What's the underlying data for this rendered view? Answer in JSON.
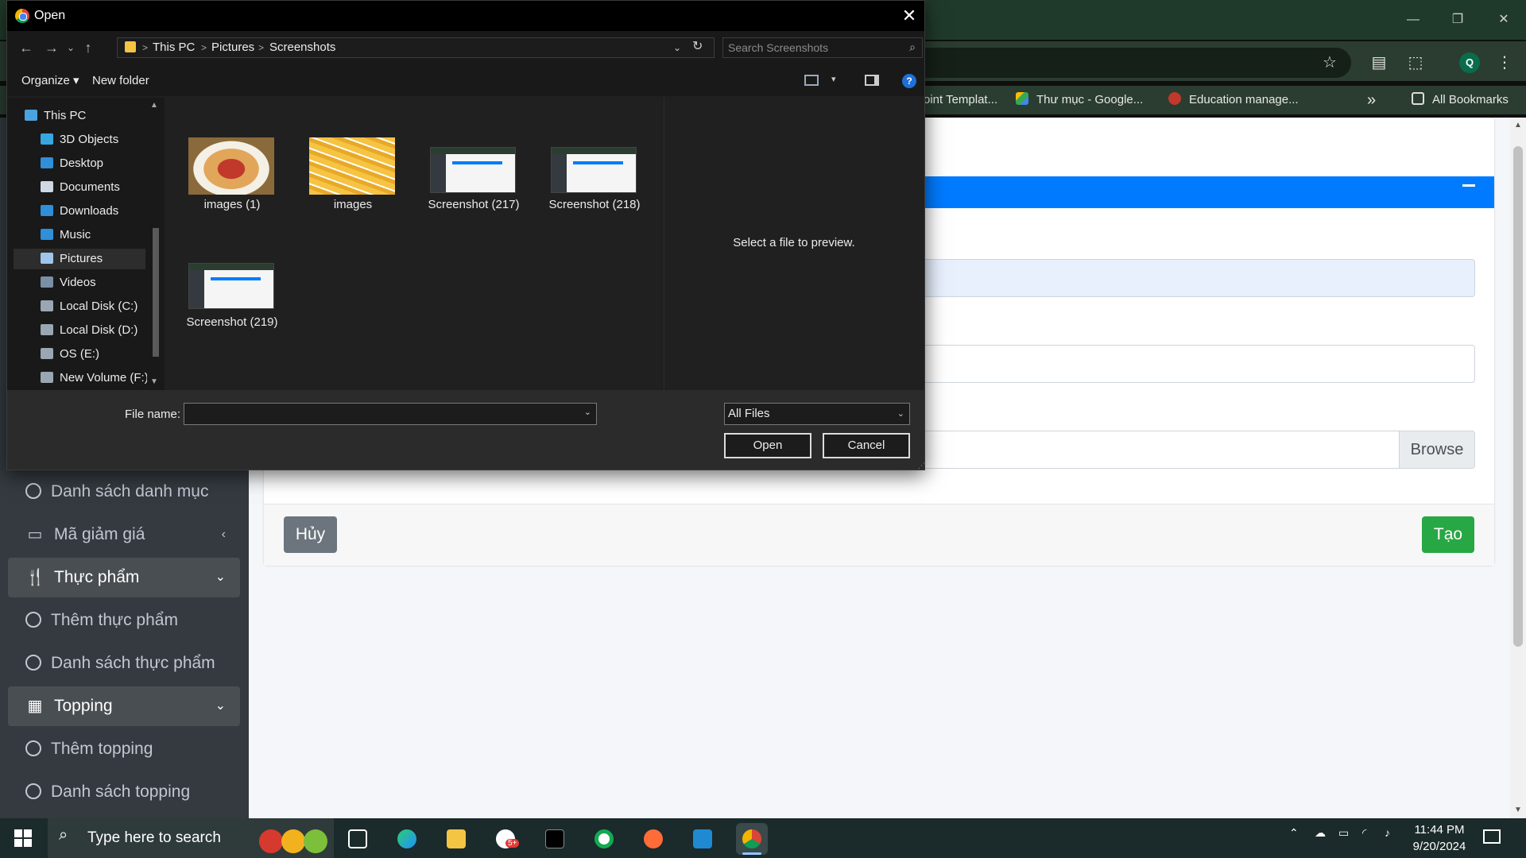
{
  "browser": {
    "bookmarks": [
      {
        "label": "oint Templat...",
        "icon": "template-icon"
      },
      {
        "label": "Thư mục - Google...",
        "icon": "google-drive-icon"
      },
      {
        "label": "Education manage...",
        "icon": "education-icon"
      }
    ],
    "bookmarks_overflow": "»",
    "all_bookmarks": "All Bookmarks",
    "profile_initial": "Q",
    "accent_color": "#1f3a2a"
  },
  "web": {
    "sidebar": [
      {
        "label": "Danh sách danh mục",
        "type": "sub"
      },
      {
        "label": "Mã giảm giá",
        "type": "section",
        "icon": "ticket-icon",
        "arrow": "‹"
      },
      {
        "label": "Thực phẩm",
        "type": "header",
        "icon": "utensils-icon",
        "arrow": "⌄"
      },
      {
        "label": "Thêm thực phẩm",
        "type": "sub"
      },
      {
        "label": "Danh sách thực phẩm",
        "type": "sub"
      },
      {
        "label": "Topping",
        "type": "header",
        "icon": "table-icon",
        "arrow": "⌄"
      },
      {
        "label": "Thêm topping",
        "type": "sub"
      },
      {
        "label": "Danh sách topping",
        "type": "sub"
      }
    ],
    "browse_label": "Browse",
    "cancel_label": "Hủy",
    "create_label": "Tạo",
    "primary_color": "#007bff",
    "success_color": "#28a745"
  },
  "dialog": {
    "title": "Open",
    "breadcrumb": [
      "This PC",
      "Pictures",
      "Screenshots"
    ],
    "search_placeholder": "Search Screenshots",
    "organize_label": "Organize ▾",
    "new_folder_label": "New folder",
    "help_label": "?",
    "tree": [
      {
        "label": "This PC",
        "icon": "pc-icon",
        "color": "#4aa3df"
      },
      {
        "label": "3D Objects",
        "icon": "3d-objects-icon",
        "color": "#37a7e0"
      },
      {
        "label": "Desktop",
        "icon": "desktop-icon",
        "color": "#2f8fd8"
      },
      {
        "label": "Documents",
        "icon": "documents-icon",
        "color": "#cfd8e3"
      },
      {
        "label": "Downloads",
        "icon": "downloads-icon",
        "color": "#2f8fd8"
      },
      {
        "label": "Music",
        "icon": "music-icon",
        "color": "#2f8fd8"
      },
      {
        "label": "Pictures",
        "icon": "pictures-icon",
        "color": "#9fc6ea",
        "selected": true
      },
      {
        "label": "Videos",
        "icon": "videos-icon",
        "color": "#7b8fa5"
      },
      {
        "label": "Local Disk (C:)",
        "icon": "disk-icon",
        "color": "#9aa6b2"
      },
      {
        "label": "Local Disk (D:)",
        "icon": "disk-icon",
        "color": "#9aa6b2"
      },
      {
        "label": "OS (E:)",
        "icon": "disk-icon",
        "color": "#9aa6b2"
      },
      {
        "label": "New Volume (F:)",
        "icon": "disk-icon",
        "color": "#9aa6b2"
      }
    ],
    "files": [
      {
        "name": "images (1)",
        "kind": "plate"
      },
      {
        "name": "images",
        "kind": "fries"
      },
      {
        "name": "Screenshot (217)",
        "kind": "shot"
      },
      {
        "name": "Screenshot (218)",
        "kind": "shot"
      },
      {
        "name": "Screenshot (219)",
        "kind": "shot"
      }
    ],
    "preview_text": "Select a file to preview.",
    "file_name_label": "File name:",
    "file_name_value": "",
    "file_type": "All Files",
    "open_label": "Open",
    "cancel_label": "Cancel"
  },
  "taskbar": {
    "search_placeholder": "Type here to search",
    "time": "11:44 PM",
    "date": "9/20/2024",
    "zalo_badge": "5+"
  }
}
